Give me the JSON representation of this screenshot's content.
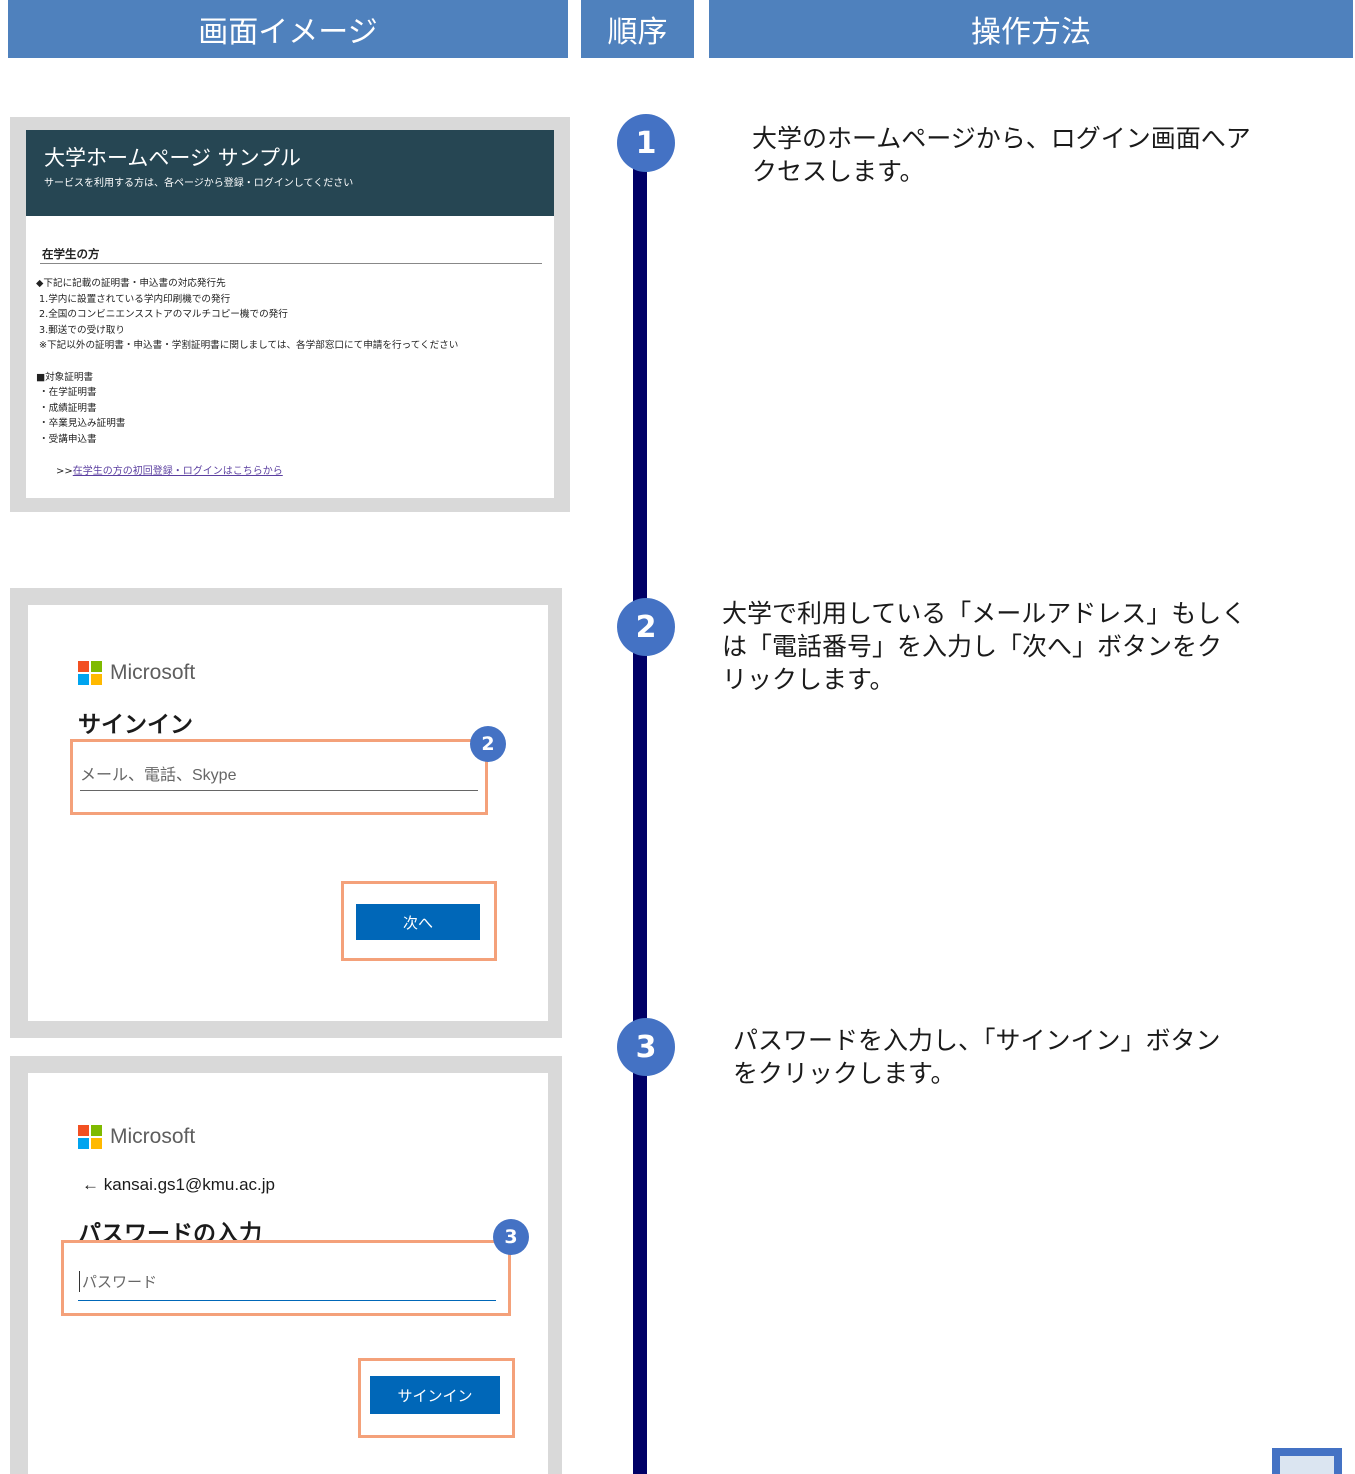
{
  "header": {
    "col_image": "画面イメージ",
    "col_order": "順序",
    "col_method": "操作方法"
  },
  "panel1": {
    "title": "大学ホームページ サンプル",
    "subtitle": "サービスを利用する方は、各ページから登録・ログインしてください",
    "section_heading": "在学生の方",
    "lines": [
      "◆下記に記載の証明書・申込書の対応発行先",
      " 1.学内に設置されている学内印刷機での発行",
      " 2.全国のコンビニエンスストアのマルチコピー機での発行",
      " 3.郵送での受け取り",
      " ※下記以外の証明書・申込書・学割証明書に関しましては、各学部窓口にて申請を行ってください",
      "",
      "■対象証明書",
      " ・在学証明書",
      " ・成績証明書",
      " ・卒業見込み証明書",
      " ・受講申込書"
    ],
    "link_prefix": ">>",
    "link_text": "在学生の方の初回登録・ログインはこちらから"
  },
  "panel2": {
    "brand": "Microsoft",
    "heading": "サインイン",
    "input_placeholder": "メール、電話、Skype",
    "badge": "2",
    "next_button": "次へ"
  },
  "panel3": {
    "brand": "Microsoft",
    "back_arrow": "←",
    "account": "kansai.gs1@kmu.ac.jp",
    "heading": "パスワードの入力",
    "input_placeholder": "パスワード",
    "badge": "3",
    "signin_button": "サインイン"
  },
  "steps": [
    {
      "number": "1",
      "line1": "大学のホームページから、ログイン画面へア",
      "line2": "クセスします。",
      "line3": ""
    },
    {
      "number": "2",
      "line1": "大学で利用している「メールアドレス」もしく",
      "line2": "は「電話番号」を入力し「次へ」ボタンをク",
      "line3": "リックします。"
    },
    {
      "number": "3",
      "line1": "パスワードを入力し、「サインイン」ボタン",
      "line2": "をクリックします。",
      "line3": ""
    }
  ],
  "colors": {
    "header_bg": "#4f81bd",
    "badge_bg": "#4472c4",
    "timeline": "#000066",
    "highlight": "#f4a17a",
    "ms_button": "#0067b8",
    "banner_bg": "#264653",
    "ms_red": "#f25022",
    "ms_green": "#7fba00",
    "ms_blue": "#00a4ef",
    "ms_yellow": "#ffb900"
  }
}
